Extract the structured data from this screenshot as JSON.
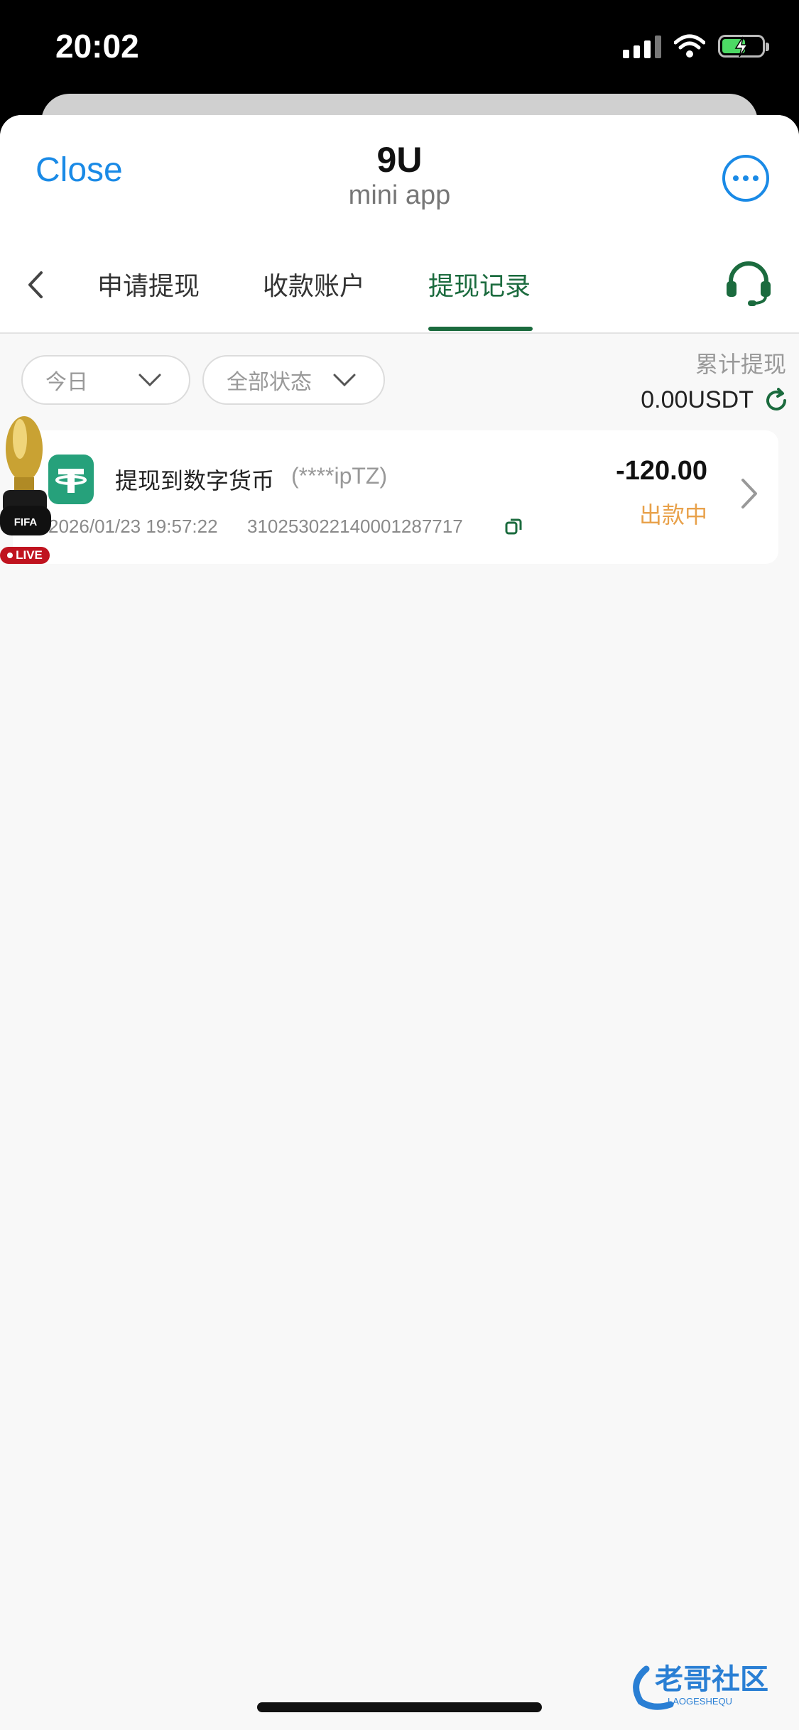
{
  "status_bar": {
    "time": "20:02"
  },
  "mini_app": {
    "close_label": "Close",
    "title": "9U",
    "subtitle": "mini app"
  },
  "tabs": [
    {
      "label": "申请提现",
      "active": false
    },
    {
      "label": "收款账户",
      "active": false
    },
    {
      "label": "提现记录",
      "active": true
    }
  ],
  "filters": {
    "date": "今日",
    "status": "全部状态"
  },
  "summary": {
    "label": "累计提现",
    "value": "0.00USDT"
  },
  "records": [
    {
      "title": "提现到数字货币",
      "account_mask": "(****ipTZ)",
      "datetime": "2026/01/23 19:57:22",
      "order_id": "310253022140001287717",
      "amount": "-120.00",
      "status": "出款中"
    }
  ],
  "badges": {
    "fifa": "FIFA",
    "live": "LIVE"
  },
  "watermark": {
    "brand": "老哥社区",
    "sub": "LAOGESHEQU"
  },
  "colors": {
    "accent_green": "#1b6b3e",
    "link_blue": "#1a8ae6",
    "status_orange": "#e8a14a",
    "tether": "#26a17b"
  },
  "icons": [
    "signal-icon",
    "wifi-icon",
    "battery-icon",
    "more-icon",
    "back-icon",
    "headset-icon",
    "chevron-down-icon",
    "refresh-icon",
    "tether-icon",
    "copy-icon",
    "chevron-right-icon",
    "fifa-trophy-icon"
  ]
}
